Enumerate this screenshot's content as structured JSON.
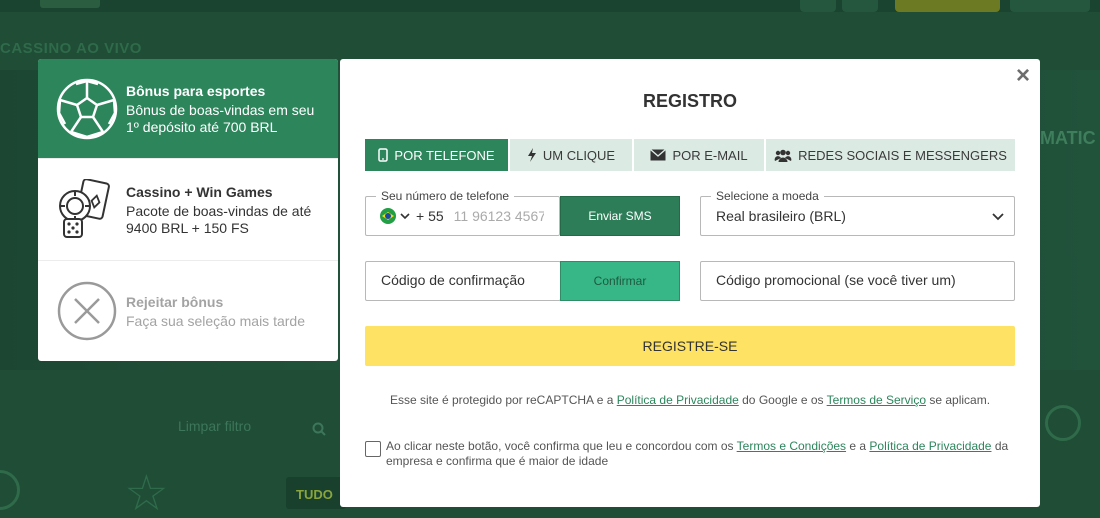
{
  "background": {
    "nav_section": "CASSINO AO VIVO",
    "right_label": "MATIC",
    "clear_filters": "Limpar filtro",
    "all_tab": "TUDO",
    "star": "☆"
  },
  "bonuses": [
    {
      "title": "Bônus para esportes",
      "desc": "Bônus de boas-vindas em seu 1º depósito até 700 BRL",
      "icon": "soccer-ball-icon",
      "active": true
    },
    {
      "title": "Cassino + Win Games",
      "desc": "Pacote de boas-vindas de até 9400 BRL + 150 FS",
      "icon": "casino-chips-icon",
      "active": false
    },
    {
      "title": "Rejeitar bônus",
      "desc": "Faça sua seleção mais tarde",
      "icon": "reject-icon",
      "active": false
    }
  ],
  "modal": {
    "close": "×",
    "title": "REGISTRO",
    "tabs": [
      {
        "label": "POR TELEFONE",
        "icon": "phone-icon",
        "active": true
      },
      {
        "label": "UM CLIQUE",
        "icon": "lightning-icon",
        "active": false
      },
      {
        "label": "POR E-MAIL",
        "icon": "envelope-icon",
        "active": false
      },
      {
        "label": "REDES SOCIAIS E MESSENGERS",
        "icon": "users-icon",
        "active": false
      }
    ],
    "phone": {
      "legend": "Seu número de telefone",
      "country_code": "+ 55",
      "placeholder": "11 96123 4567",
      "send_sms": "Enviar SMS"
    },
    "currency": {
      "legend": "Selecione a moeda",
      "value": "Real brasileiro (BRL)"
    },
    "confirmation": {
      "placeholder": "Código de confirmação",
      "confirm": "Confirmar"
    },
    "promo": {
      "placeholder": "Código promocional (se você tiver um)"
    },
    "register": "REGISTRE-SE",
    "recaptcha": {
      "prefix": "Esse site é protegido por reCAPTCHA e a ",
      "privacy": "Política de Privacidade",
      "middle": " do Google e os ",
      "terms": "Termos de Serviço",
      "suffix": " se aplicam."
    },
    "consent": {
      "prefix": "Ao clicar neste botão, você confirma que leu e concordou com os ",
      "terms": "Termos e Condições",
      "middle": " e a ",
      "privacy": "Política de Privacidade",
      "suffix": " da empresa e confirma que é maior de idade"
    }
  },
  "colors": {
    "brand_green": "#2d855c",
    "register_yellow": "#fde264",
    "confirm_green": "#37b787",
    "background": "#1f4d36"
  }
}
